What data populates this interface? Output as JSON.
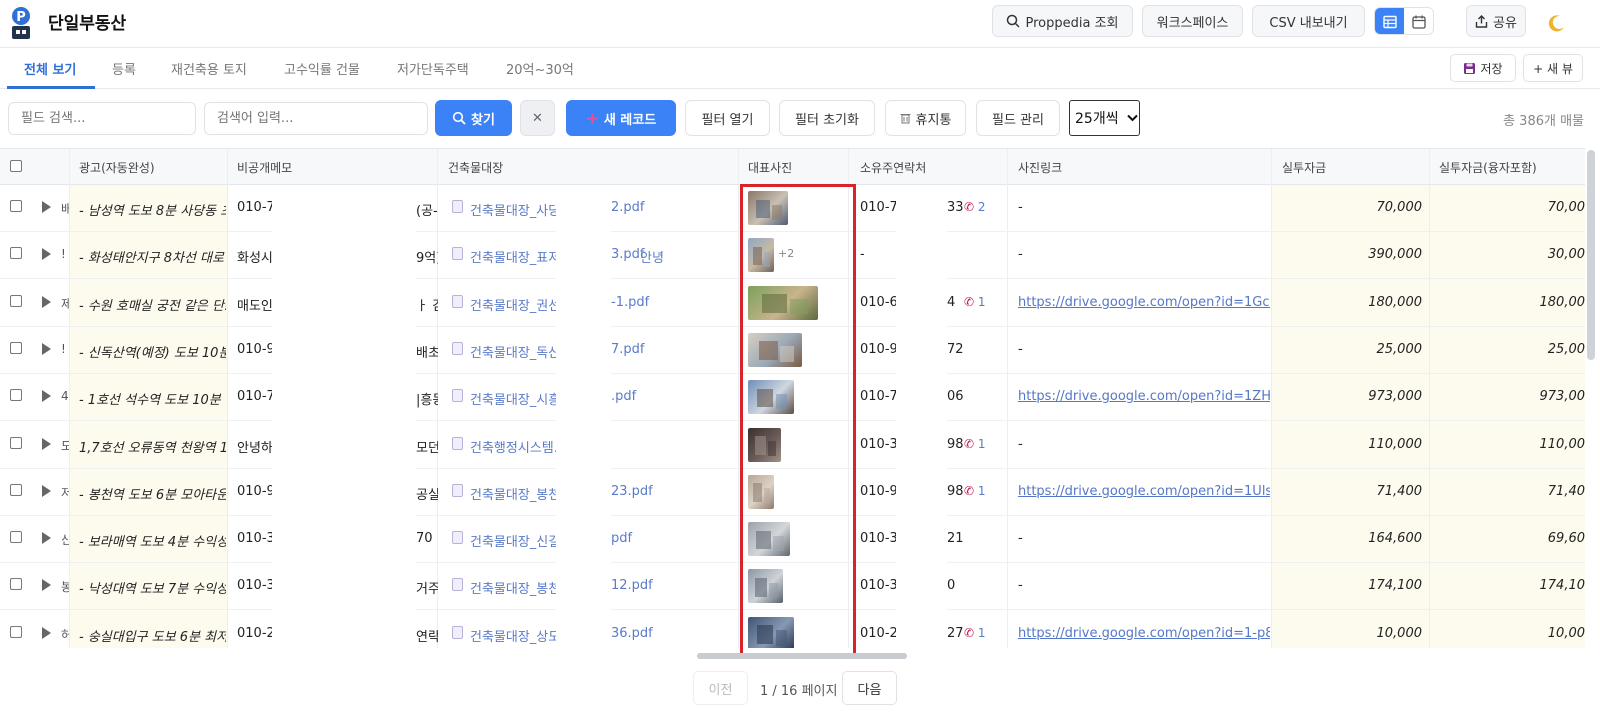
{
  "app": {
    "title": "단일부동산"
  },
  "header": {
    "proppedia_label": "Proppedia 조회",
    "workspace_label": "워크스페이스",
    "csv_label": "CSV 내보내기",
    "share_label": "공유"
  },
  "tabs": [
    {
      "label": "전체 보기",
      "active": true
    },
    {
      "label": "등록"
    },
    {
      "label": "재건축용 토지"
    },
    {
      "label": "고수익률 건물"
    },
    {
      "label": "저가단독주택"
    },
    {
      "label": "20억~30억"
    }
  ],
  "view_actions": {
    "save_label": "저장",
    "new_view_label": "+ 새 뷰"
  },
  "toolbar": {
    "field_search_placeholder": "필드 검색...",
    "search_placeholder": "검색어 입력...",
    "find_label": "찾기",
    "clear_label": "✕",
    "new_record_label": "새 레코드",
    "filter_open_label": "필터 열기",
    "filter_reset_label": "필터 초기화",
    "trash_label": "휴지통",
    "field_manage_label": "필드 관리",
    "page_size_label": "25개씩",
    "total_label": "총 386개 매물"
  },
  "table": {
    "headers": [
      "광고(자동완성)",
      "비공개메모",
      "건축물대장",
      "대표사진",
      "소유주연락처",
      "사진링크",
      "실투자금",
      "실투자금(융자포함)"
    ],
    "rows": [
      {
        "c0": "배",
        "ad": "- 남성역 도보 8분 사당동 초",
        "memo": "010-7",
        "memo2": "(공-",
        "doc": "건축물대장_사당",
        "doc2": "2.pdf",
        "extra": "",
        "photo": "p1",
        "photo_more": "",
        "owner": "010-7",
        "owner2": "33",
        "calls": "2",
        "link": "-",
        "invest": "70,000",
        "invest2": "70,00"
      },
      {
        "c0": "!",
        "ad": "- 화성태안지구 8차선 대로",
        "memo": "화성시",
        "memo2": "9억)",
        "doc": "건축물대장_표저",
        "doc2": "3.pdf",
        "extra": "안녕",
        "photo": "p2",
        "photo_more": "+2",
        "owner": "-",
        "owner2": "",
        "calls": "",
        "link": "-",
        "invest": "390,000",
        "invest2": "30,00"
      },
      {
        "c0": "제",
        "ad": "- 수원 호매실 궁전 같은 단!",
        "memo": "매도인",
        "memo2": "ㅏ 김",
        "doc": "건축물대장_권선",
        "doc2": "-1.pdf",
        "extra": "",
        "photo": "p3",
        "photo_more": "",
        "owner": "010-6",
        "owner2": "4",
        "calls": "1",
        "link": "https://drive.google.com/open?id=1GcgO",
        "invest": "180,000",
        "invest2": "180,00"
      },
      {
        "c0": "!",
        "ad": "- 신독산역(예정) 도보 10분",
        "memo": "010-9",
        "memo2": "배초지",
        "doc": "건축물대장_독산",
        "doc2": "7.pdf",
        "extra": "",
        "photo": "p4",
        "photo_more": "",
        "owner": "010-9",
        "owner2": "72",
        "calls": "",
        "link": "-",
        "invest": "25,000",
        "invest2": "25,00"
      },
      {
        "c0": "4",
        "ad": "- 1호선 석수역 도보 10분 ㄹ",
        "memo": "010-7",
        "memo2": "|흥동",
        "doc": "건축물대장_시흥",
        "doc2": ".pdf",
        "extra": "",
        "photo": "p5",
        "photo_more": "",
        "owner": "010-7",
        "owner2": "06",
        "calls": "",
        "link": "https://drive.google.com/open?id=1ZHuJ:",
        "invest": "973,000",
        "invest2": "973,00"
      },
      {
        "c0": "도",
        "ad": "1,7호선 오류동역 천왕역 10",
        "memo": "안녕하",
        "memo2": "모던",
        "doc": "건축행정시스템.",
        "doc2": "",
        "extra": "",
        "photo": "p6",
        "photo_more": "",
        "owner": "010-3",
        "owner2": "98",
        "calls": "1",
        "link": "-",
        "invest": "110,000",
        "invest2": "110,00"
      },
      {
        "c0": "저",
        "ad": "- 봉천역 도보 6분 모아타운",
        "memo": "010-9",
        "memo2": "공실",
        "doc": "건축물대장_봉천",
        "doc2": "23.pdf",
        "extra": "",
        "photo": "p7",
        "photo_more": "",
        "owner": "010-9",
        "owner2": "98",
        "calls": "1",
        "link": "https://drive.google.com/open?id=1UlsUN",
        "invest": "71,400",
        "invest2": "71,40"
      },
      {
        "c0": "신",
        "ad": "- 보라매역 도보 4분 수익성",
        "memo": "010-3",
        "memo2": "70",
        "doc": "건축물대장_신길",
        "doc2": "pdf",
        "extra": "",
        "photo": "p8",
        "photo_more": "",
        "owner": "010-3",
        "owner2": "21",
        "calls": "",
        "link": "-",
        "invest": "164,600",
        "invest2": "69,60"
      },
      {
        "c0": "봉",
        "ad": "- 낙성대역 도보 7분 수익성",
        "memo": "010-3",
        "memo2": "거주",
        "doc": "건축물대장_봉천",
        "doc2": "12.pdf",
        "extra": "",
        "photo": "p9",
        "photo_more": "",
        "owner": "010-3",
        "owner2": "0",
        "calls": "",
        "link": "-",
        "invest": "174,100",
        "invest2": "174,10"
      },
      {
        "c0": "허",
        "ad": "- 숭실대입구 도보 6분 최저",
        "memo": "010-2",
        "memo2": "연락",
        "doc": "건축물대장_상도",
        "doc2": "36.pdf",
        "extra": "",
        "photo": "p10",
        "photo_more": "",
        "owner": "010-2",
        "owner2": "27",
        "calls": "1",
        "link": "https://drive.google.com/open?id=1-p8Br",
        "invest": "10,000",
        "invest2": "10,00"
      }
    ]
  },
  "pagination": {
    "prev_label": "이전",
    "info": "1 / 16 페이지",
    "next_label": "다음"
  },
  "colors": {
    "accent": "#3b82f6",
    "highlight": "#d8232a",
    "link": "#5577c8",
    "phone": "#c2185b"
  }
}
